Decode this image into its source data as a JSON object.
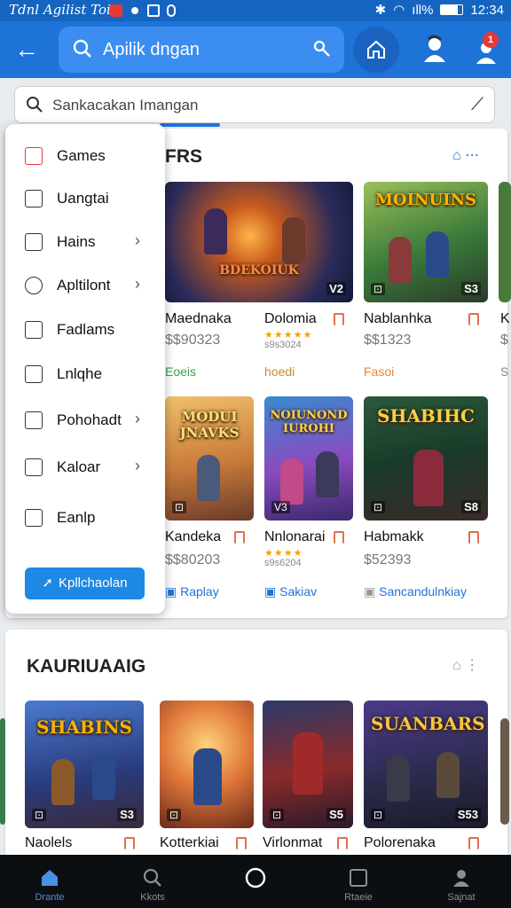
{
  "status": {
    "left": "Tdnl Agilist Toil",
    "time": "12:34",
    "signal": "ıll%"
  },
  "topbar": {
    "search_text": "Apilik dngan",
    "colors": {
      "bar": "#1e73d8"
    }
  },
  "search2": {
    "text": "Sankacakan Imangan"
  },
  "section1": {
    "title": "FRS",
    "games": [
      {
        "title": "BDEKOIUK",
        "name": "Maednaka",
        "price": "$$90323",
        "tag": "Eoeis",
        "thumb_tag": "V2"
      },
      {
        "title": "",
        "name": "Dolomia",
        "price": "",
        "sub": "s9s3024",
        "tag": "hoedi",
        "stars": "★★★★★"
      },
      {
        "title": "MOINUINS",
        "name": "Nablanhka",
        "price": "$$1323",
        "tag": "Fasoi",
        "thumb_tag": "S3"
      },
      {
        "title": "",
        "name": "K",
        "price": "$",
        "tag": "S",
        "partial": true
      },
      {
        "title": "MODUI JNAVKS",
        "name": "Kandeka",
        "price": "$$80203",
        "tag": "Raplay"
      },
      {
        "title": "NOIUNOND IUROHI",
        "name": "Nnlonarai",
        "price": "",
        "sub": "s9s6204",
        "stars": "★★★★",
        "tag": "Sakiav",
        "thumb_tag": "V3"
      },
      {
        "title": "SHABIHC",
        "name": "Habmakk",
        "price": "$52393",
        "tag": "Sancandulnkiay",
        "thumb_tag": "S8"
      }
    ]
  },
  "menu": {
    "items": [
      {
        "label": "Games",
        "chevron": false
      },
      {
        "label": "Uangtai",
        "chevron": false
      },
      {
        "label": "Hains",
        "chevron": true
      },
      {
        "label": "Apltilont",
        "chevron": true
      },
      {
        "label": "Fadlams",
        "chevron": false
      },
      {
        "label": "Lnlqhe",
        "chevron": false
      },
      {
        "label": "Pohohadt",
        "chevron": true
      },
      {
        "label": "Kaloar",
        "chevron": true
      },
      {
        "label": "Eanlp",
        "chevron": false
      }
    ],
    "apply_label": "Kpllchaolan"
  },
  "section2": {
    "title": "KAURIUAAIG",
    "games": [
      {
        "title": "SHABINS",
        "name": "Naolels",
        "thumb_tag": "S3"
      },
      {
        "title": "",
        "name": "Kotterkiai"
      },
      {
        "title": "",
        "name": "Virlonmat",
        "thumb_tag": "S5"
      },
      {
        "title": "SUANBARS",
        "name": "Polorenaka",
        "thumb_tag": "S53"
      }
    ]
  },
  "bottomnav": [
    {
      "label": "Drante",
      "active": true,
      "icon": "home-icon"
    },
    {
      "label": "Kkots",
      "active": false,
      "icon": "search-icon"
    },
    {
      "label": "",
      "active": false,
      "icon": "circle-icon"
    },
    {
      "label": "Rtaeie",
      "active": false,
      "icon": "square-icon"
    },
    {
      "label": "Sajnat",
      "active": false,
      "icon": "person-icon"
    }
  ]
}
